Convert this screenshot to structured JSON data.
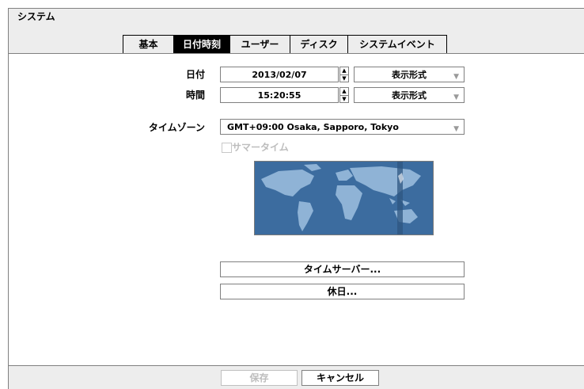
{
  "window": {
    "title": "システム"
  },
  "tabs": [
    {
      "label": "基本"
    },
    {
      "label": "日付時刻"
    },
    {
      "label": "ユーザー"
    },
    {
      "label": "ディスク"
    },
    {
      "label": "システムイベント"
    }
  ],
  "date": {
    "label": "日付",
    "value": "2013/02/07",
    "format": "表示形式"
  },
  "time": {
    "label": "時間",
    "value": "15:20:55",
    "format": "表示形式"
  },
  "timezone": {
    "label": "タイムゾーン",
    "value": "GMT+09:00  Osaka, Sapporo, Tokyo"
  },
  "dst": {
    "label": "サマータイム",
    "checked": false,
    "enabled": false
  },
  "buttons": {
    "time_server": "タイムサーバー...",
    "holiday": "休日..."
  },
  "footer": {
    "save": "保存",
    "cancel": "キャンセル"
  },
  "colors": {
    "map_ocean": "#3c6c9f",
    "map_land": "#8fb3d6",
    "tab_active": "#000000"
  }
}
